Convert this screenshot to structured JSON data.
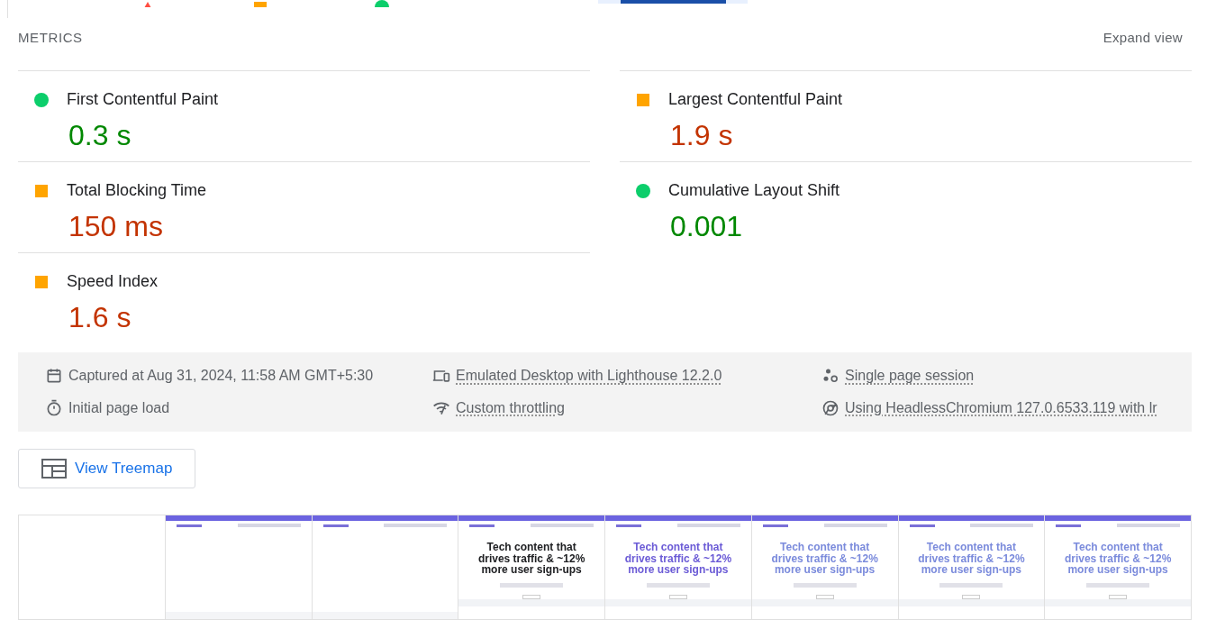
{
  "legend": [
    {
      "kind": "fail"
    },
    {
      "kind": "average"
    },
    {
      "kind": "pass"
    }
  ],
  "metrics_header": {
    "title": "METRICS",
    "toggle": "Expand view"
  },
  "metrics": [
    {
      "name": "First Contentful Paint",
      "value": "0.3 s",
      "kind": "pass"
    },
    {
      "name": "Largest Contentful Paint",
      "value": "1.9 s",
      "kind": "average"
    },
    {
      "name": "Total Blocking Time",
      "value": "150 ms",
      "kind": "average"
    },
    {
      "name": "Cumulative Layout Shift",
      "value": "0.001",
      "kind": "pass"
    },
    {
      "name": "Speed Index",
      "value": "1.6 s",
      "kind": "average"
    }
  ],
  "run_info": [
    {
      "kind": "calendar",
      "text": "Captured at Aug 31, 2024, 11:58 AM GMT+5:30",
      "link": false
    },
    {
      "kind": "devices",
      "text": "Emulated Desktop with Lighthouse 12.2.0",
      "link": true
    },
    {
      "kind": "session",
      "text": "Single page session",
      "link": true
    },
    {
      "kind": "timer",
      "text": "Initial page load",
      "link": false
    },
    {
      "kind": "network",
      "text": "Custom throttling",
      "link": true
    },
    {
      "kind": "browser",
      "text": "Using HeadlessChromium 127.0.6533.119 with lr",
      "link": true
    }
  ],
  "treemap_button": "View Treemap",
  "filmstrip": [
    {
      "kind": "blank"
    },
    {
      "kind": "header"
    },
    {
      "kind": "header"
    },
    {
      "kind": "full",
      "color": "#202124",
      "headline": [
        "Tech content that",
        "drives traffic & ~12%",
        "more user sign-ups"
      ]
    },
    {
      "kind": "full",
      "color": "#6b5bd6",
      "headline": [
        "Tech content that",
        "drives traffic & ~12%",
        "more user sign-ups"
      ]
    },
    {
      "kind": "full",
      "color": "#7b8bdc",
      "headline": [
        "Tech content that",
        "drives traffic & ~12%",
        "more user sign-ups"
      ]
    },
    {
      "kind": "full",
      "color": "#7b8bdc",
      "headline": [
        "Tech content that",
        "drives traffic & ~12%",
        "more user sign-ups"
      ]
    },
    {
      "kind": "full",
      "color": "#7b8bdc",
      "headline": [
        "Tech content that",
        "drives traffic & ~12%",
        "more user sign-ups"
      ]
    }
  ]
}
